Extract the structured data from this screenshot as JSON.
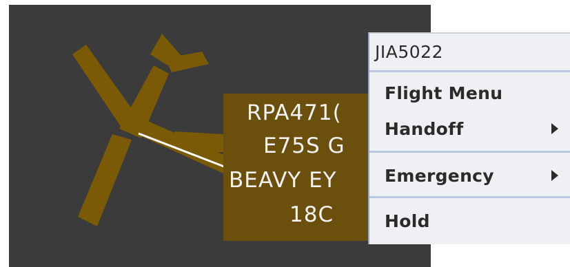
{
  "scope": {
    "background_color": "#3b3b3b",
    "aircraft_icon": "airplane-icon",
    "aircraft_color": "#7a5a05"
  },
  "datablock": {
    "line1": "RPA471(",
    "line2": "E75S G",
    "line3": "BEAVY EY",
    "line4": "18C",
    "background_color": "#6b4f0d"
  },
  "context_menu": {
    "title": "JIA5022",
    "items": [
      {
        "label": "Flight Menu",
        "submenu": false
      },
      {
        "label": "Handoff",
        "submenu": true
      },
      {
        "label": "Emergency",
        "submenu": true
      },
      {
        "label": "Hold",
        "submenu": false
      }
    ],
    "submenu_icon": "chevron-right-icon",
    "separator_color": "#b9c6e0",
    "background_color": "#eef0f4"
  }
}
